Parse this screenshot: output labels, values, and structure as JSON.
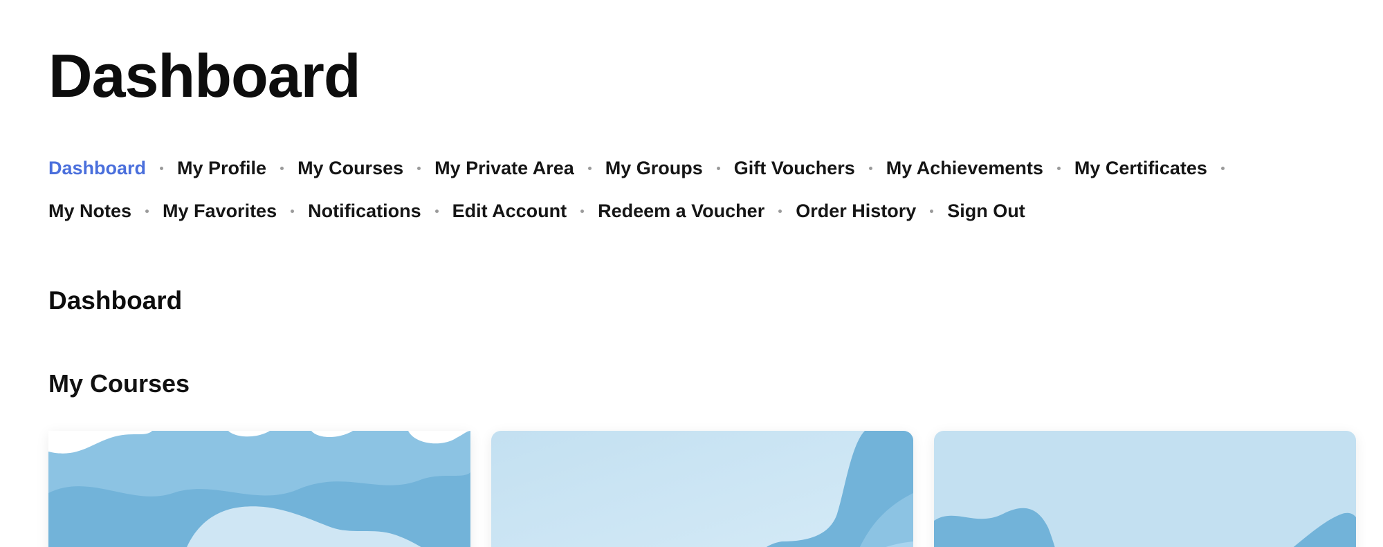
{
  "page_title": "Dashboard",
  "nav": {
    "row1": [
      "Dashboard",
      "My Profile",
      "My Courses",
      "My Private Area",
      "My Groups",
      "Gift Vouchers",
      "My Achievements",
      "My Certificates"
    ],
    "row2": [
      "My Notes",
      "My Favorites",
      "Notifications",
      "Edit Account",
      "Redeem a Voucher",
      "Order History",
      "Sign Out"
    ],
    "active": "Dashboard",
    "active_color": "#4a6fdc"
  },
  "section_title": "Dashboard",
  "courses_title": "My Courses",
  "colors": {
    "card_light": "#c3e0f1",
    "card_mid": "#8cc3e3",
    "card_dark": "#72b3d9"
  }
}
